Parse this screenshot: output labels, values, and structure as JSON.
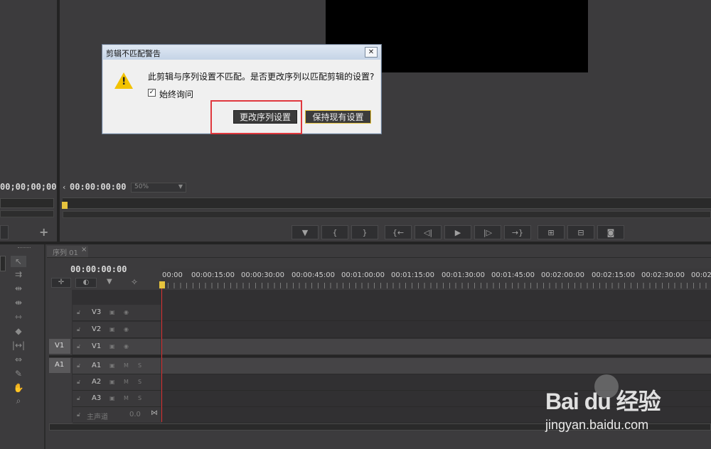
{
  "source_monitor": {
    "timecode": "00;00;00;00",
    "add_icon": "+"
  },
  "program_monitor": {
    "timecode": "00:00:00:00",
    "zoom": "50%",
    "transport_buttons": [
      "marker-icon",
      "mark-in-icon",
      "mark-out-icon",
      "go-to-in-icon",
      "step-back-icon",
      "play-icon",
      "step-forward-icon",
      "go-to-out-icon",
      "lift-icon",
      "extract-icon",
      "export-frame-icon"
    ],
    "transport_glyphs": [
      "▼",
      "{",
      "}",
      "{←",
      "◁|",
      "▶",
      "|▷",
      "→}",
      "⊞",
      "⊟",
      "◙"
    ]
  },
  "dialog": {
    "title": "剪辑不匹配警告",
    "message": "此剪辑与序列设置不匹配。是否更改序列以匹配剪辑的设置?",
    "checkbox_label": "始终询问",
    "checkbox_checked": true,
    "change_button": "更改序列设置",
    "keep_button": "保持现有设置",
    "close_glyph": "✕",
    "warning_glyph": "!"
  },
  "timeline": {
    "tab_label": "序列 01",
    "tab_close": "×",
    "timecode": "00:00:00:00",
    "ruler_labels": [
      "00:00",
      "00:00:15:00",
      "00:00:30:00",
      "00:00:45:00",
      "00:01:00:00",
      "00:01:15:00",
      "00:01:30:00",
      "00:01:45:00",
      "00:02:00:00",
      "00:02:15:00",
      "00:02:30:00",
      "00:02"
    ],
    "video_tracks": [
      {
        "label": "V3",
        "source": ""
      },
      {
        "label": "V2",
        "source": ""
      },
      {
        "label": "V1",
        "source": "V1"
      }
    ],
    "audio_tracks": [
      {
        "label": "A1",
        "source": "A1",
        "m": "M",
        "s": "S"
      },
      {
        "label": "A2",
        "source": "",
        "m": "M",
        "s": "S"
      },
      {
        "label": "A3",
        "source": "",
        "m": "M",
        "s": "S"
      }
    ],
    "master": {
      "label": "主声道",
      "value": "0.0"
    }
  },
  "watermark": {
    "brand": "Bai du 经验",
    "url": "jingyan.baidu.com"
  },
  "colors": {
    "playhead": "#d33",
    "dialog_highlight": "#e0383e",
    "accent_yellow": "#e6c33d"
  }
}
